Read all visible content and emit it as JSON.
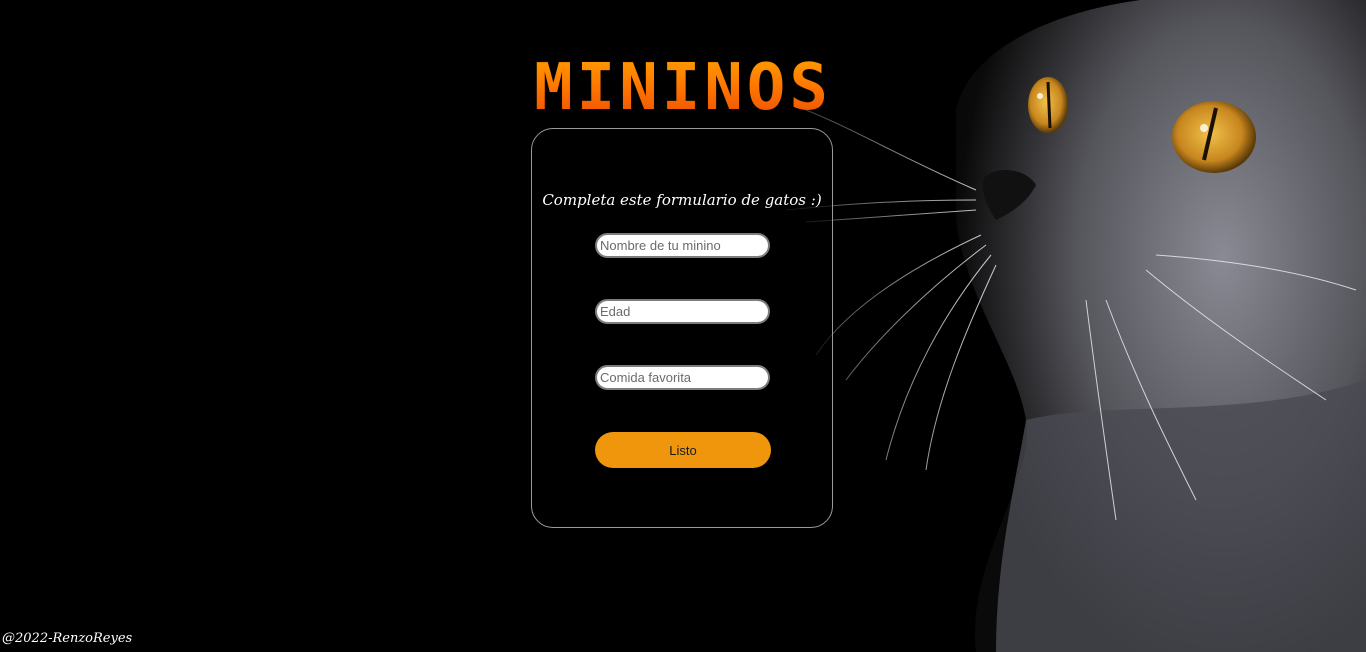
{
  "header": {
    "title": "MININOS"
  },
  "form": {
    "subtitle": "Completa este formulario de gatos :)",
    "fields": [
      {
        "placeholder": "Nombre de tu minino",
        "value": ""
      },
      {
        "placeholder": "Edad",
        "value": ""
      },
      {
        "placeholder": "Comida favorita",
        "value": ""
      }
    ],
    "submit_label": "Listo"
  },
  "footer": {
    "credit": "@2022-RenzoReyes"
  },
  "colors": {
    "background": "#000000",
    "accent": "#f0960c",
    "title_gradient_top": "#ffb000",
    "title_gradient_bottom": "#e43c00",
    "card_border": "#9a9a9a"
  },
  "background_image": {
    "icon": "cat-photo"
  }
}
